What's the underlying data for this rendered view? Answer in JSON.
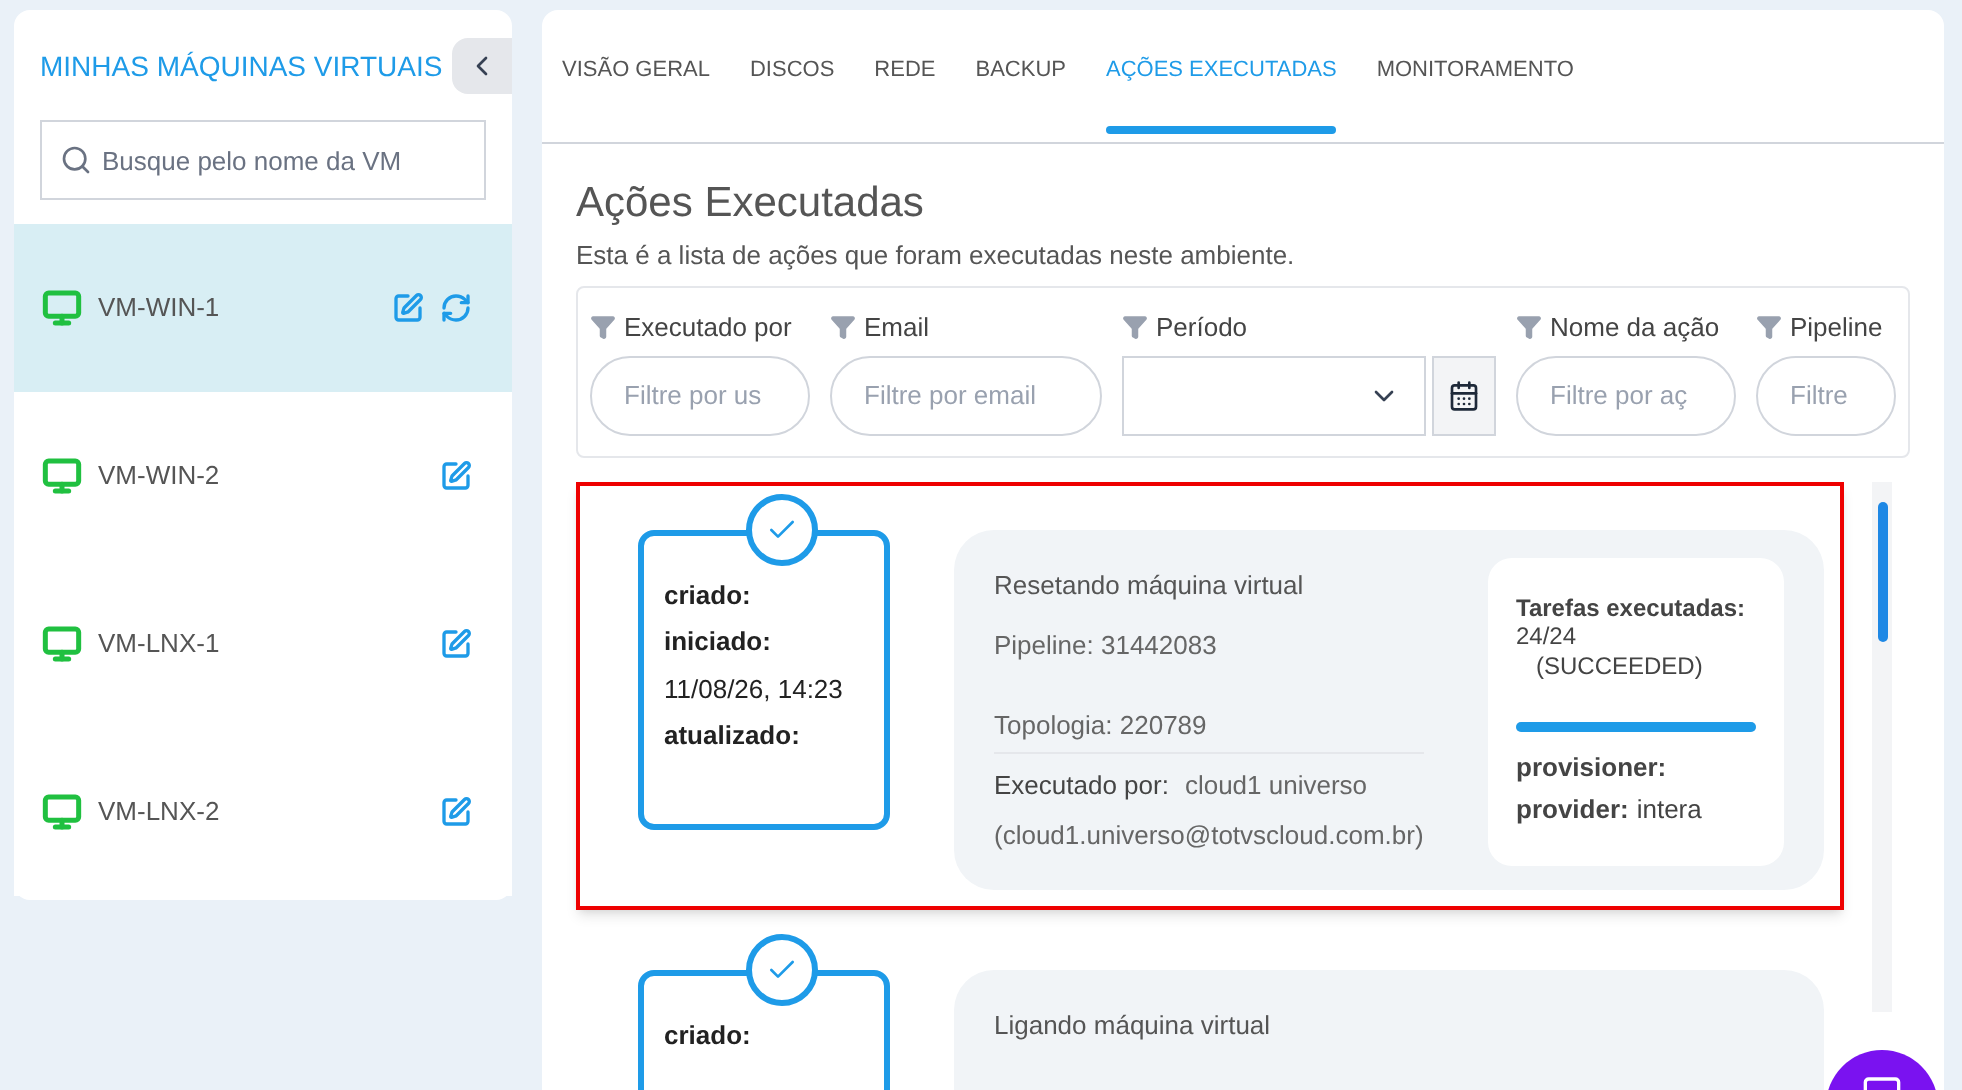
{
  "sidebar": {
    "title": "MINHAS MÁQUINAS VIRTUAIS",
    "search": {
      "placeholder": "Busque pelo nome da VM"
    },
    "items": [
      {
        "name": "VM-WIN-1",
        "selected": true,
        "refresh": true
      },
      {
        "name": "VM-WIN-2",
        "selected": false,
        "refresh": false
      },
      {
        "name": "VM-LNX-1",
        "selected": false,
        "refresh": false
      },
      {
        "name": "VM-LNX-2",
        "selected": false,
        "refresh": false
      }
    ]
  },
  "tabs": [
    {
      "label": "VISÃO GERAL",
      "selected": false
    },
    {
      "label": "DISCOS",
      "selected": false
    },
    {
      "label": "REDE",
      "selected": false
    },
    {
      "label": "BACKUP",
      "selected": false
    },
    {
      "label": "AÇÕES EXECUTADAS",
      "selected": true
    },
    {
      "label": "MONITORAMENTO",
      "selected": false
    }
  ],
  "heading": "Ações Executadas",
  "subtitle": "Esta é a lista de ações que foram executadas neste ambiente.",
  "filters": [
    {
      "kind": "text",
      "label": "Executado por",
      "placeholder": "Filtre por us"
    },
    {
      "kind": "text",
      "label": "Email",
      "placeholder": "Filtre por email"
    },
    {
      "kind": "date",
      "label": "Período"
    },
    {
      "kind": "text",
      "label": "Nome da ação",
      "placeholder": "Filtre por aç"
    },
    {
      "kind": "text",
      "label": "Pipeline",
      "placeholder": "Filtre"
    }
  ],
  "actions": [
    {
      "highlighted": true,
      "times": [
        {
          "kind": "label",
          "text": "criado:"
        },
        {
          "kind": "label",
          "text": "iniciado:"
        },
        {
          "kind": "value",
          "text": "11/08/26, 14:23"
        },
        {
          "kind": "label",
          "text": "atualizado:"
        }
      ],
      "name": "Resetando máquina virtual",
      "pipeline": "Pipeline: 31442083",
      "topology": "Topologia: 220789",
      "executed_by_label": "Executado por:",
      "executed_by": "cloud1 universo",
      "email": "(cloud1.universo@totvscloud.com.br)",
      "tasks_label": "Tarefas executadas:",
      "tasks_count": "24/24",
      "status": "(SUCCEEDED)",
      "level": 1,
      "provisioner_label": "provisioner:",
      "provider_label": "provider:",
      "provider": "intera"
    },
    {
      "highlighted": false,
      "times": [
        {
          "kind": "label",
          "text": "criado:"
        }
      ],
      "name": "Ligando máquina virtual"
    }
  ]
}
